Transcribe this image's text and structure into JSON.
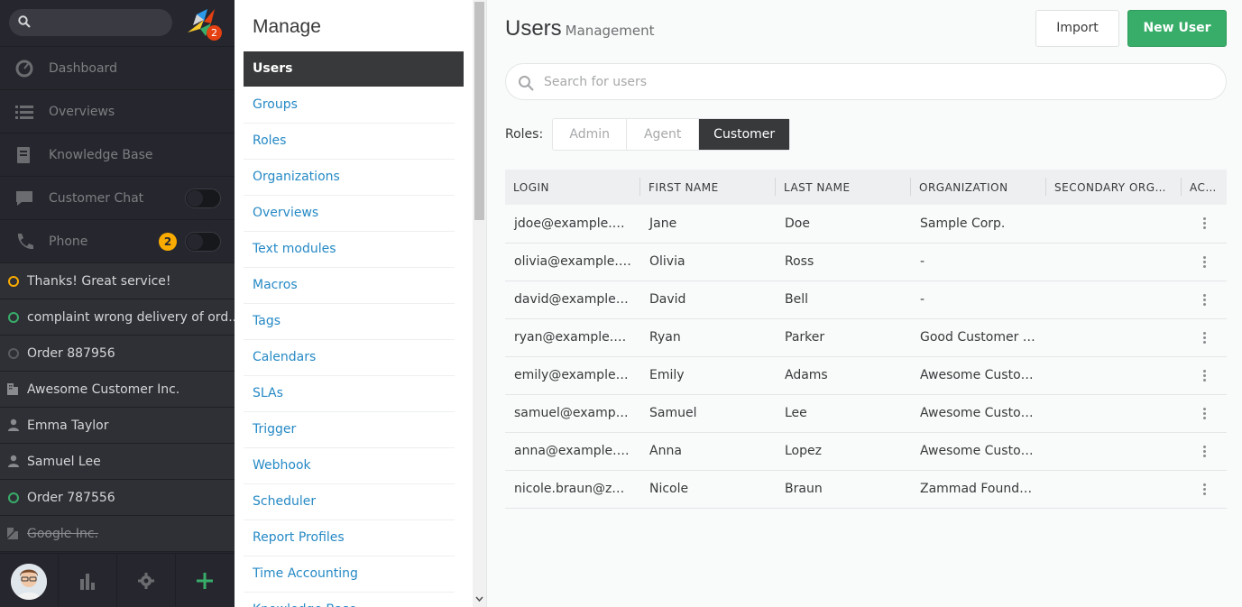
{
  "nav": {
    "logo_badge": "2",
    "menu": [
      {
        "label": "Dashboard",
        "icon": "dashboard-icon"
      },
      {
        "label": "Overviews",
        "icon": "overviews-icon"
      },
      {
        "label": "Knowledge Base",
        "icon": "knowledge-base-icon"
      },
      {
        "label": "Customer Chat",
        "icon": "chat-icon"
      },
      {
        "label": "Phone",
        "icon": "phone-icon",
        "badge": "2"
      }
    ],
    "tasks": [
      {
        "label": "Thanks! Great service!",
        "icon": "ticket-open-icon",
        "color": "#faab00"
      },
      {
        "label": "complaint wrong delivery of ord...",
        "icon": "ticket-open-icon",
        "color": "#38ad69"
      },
      {
        "label": "Order 887956",
        "icon": "ticket-closed-icon",
        "color": "#5a5b60"
      },
      {
        "label": "Awesome Customer Inc.",
        "icon": "organization-icon"
      },
      {
        "label": "Emma Taylor",
        "icon": "user-icon"
      },
      {
        "label": "Samuel Lee",
        "icon": "user-icon"
      },
      {
        "label": "Order 787556",
        "icon": "ticket-open-icon",
        "color": "#38ad69"
      },
      {
        "label": "Google Inc.",
        "icon": "organization-inactive-icon"
      }
    ]
  },
  "manage": {
    "title": "Manage",
    "items": [
      "Users",
      "Groups",
      "Roles",
      "Organizations",
      "Overviews",
      "Text modules",
      "Macros",
      "Tags",
      "Calendars",
      "SLAs",
      "Trigger",
      "Webhook",
      "Scheduler",
      "Report Profiles",
      "Time Accounting",
      "Knowledge Base"
    ],
    "active": "Users"
  },
  "main": {
    "title": "Users",
    "subtitle": "Management",
    "import_label": "Import",
    "new_user_label": "New User",
    "search_placeholder": "Search for users",
    "roles_label": "Roles:",
    "roles": [
      "Admin",
      "Agent",
      "Customer"
    ],
    "selected_role": "Customer",
    "columns": [
      "LOGIN",
      "FIRST NAME",
      "LAST NAME",
      "ORGANIZATION",
      "SECONDARY ORGANI...",
      "ACT..."
    ],
    "rows": [
      [
        "jdoe@example.com",
        "Jane",
        "Doe",
        "Sample Corp.",
        ""
      ],
      [
        "olivia@example.c...",
        "Olivia",
        "Ross",
        "-",
        ""
      ],
      [
        "david@example.c...",
        "David",
        "Bell",
        "-",
        ""
      ],
      [
        "ryan@example.com",
        "Ryan",
        "Parker",
        "Good Customer Inc.",
        ""
      ],
      [
        "emily@example.c...",
        "Emily",
        "Adams",
        "Awesome Custome...",
        ""
      ],
      [
        "samuel@example....",
        "Samuel",
        "Lee",
        "Awesome Custome...",
        ""
      ],
      [
        "anna@example.com",
        "Anna",
        "Lopez",
        "Awesome Custome...",
        ""
      ],
      [
        "nicole.braun@zam...",
        "Nicole",
        "Braun",
        "Zammad Foundati...",
        ""
      ]
    ]
  },
  "colors": {
    "accent_green": "#38ad69",
    "link_blue": "#2589c5",
    "nav_bg": "#26272e"
  }
}
